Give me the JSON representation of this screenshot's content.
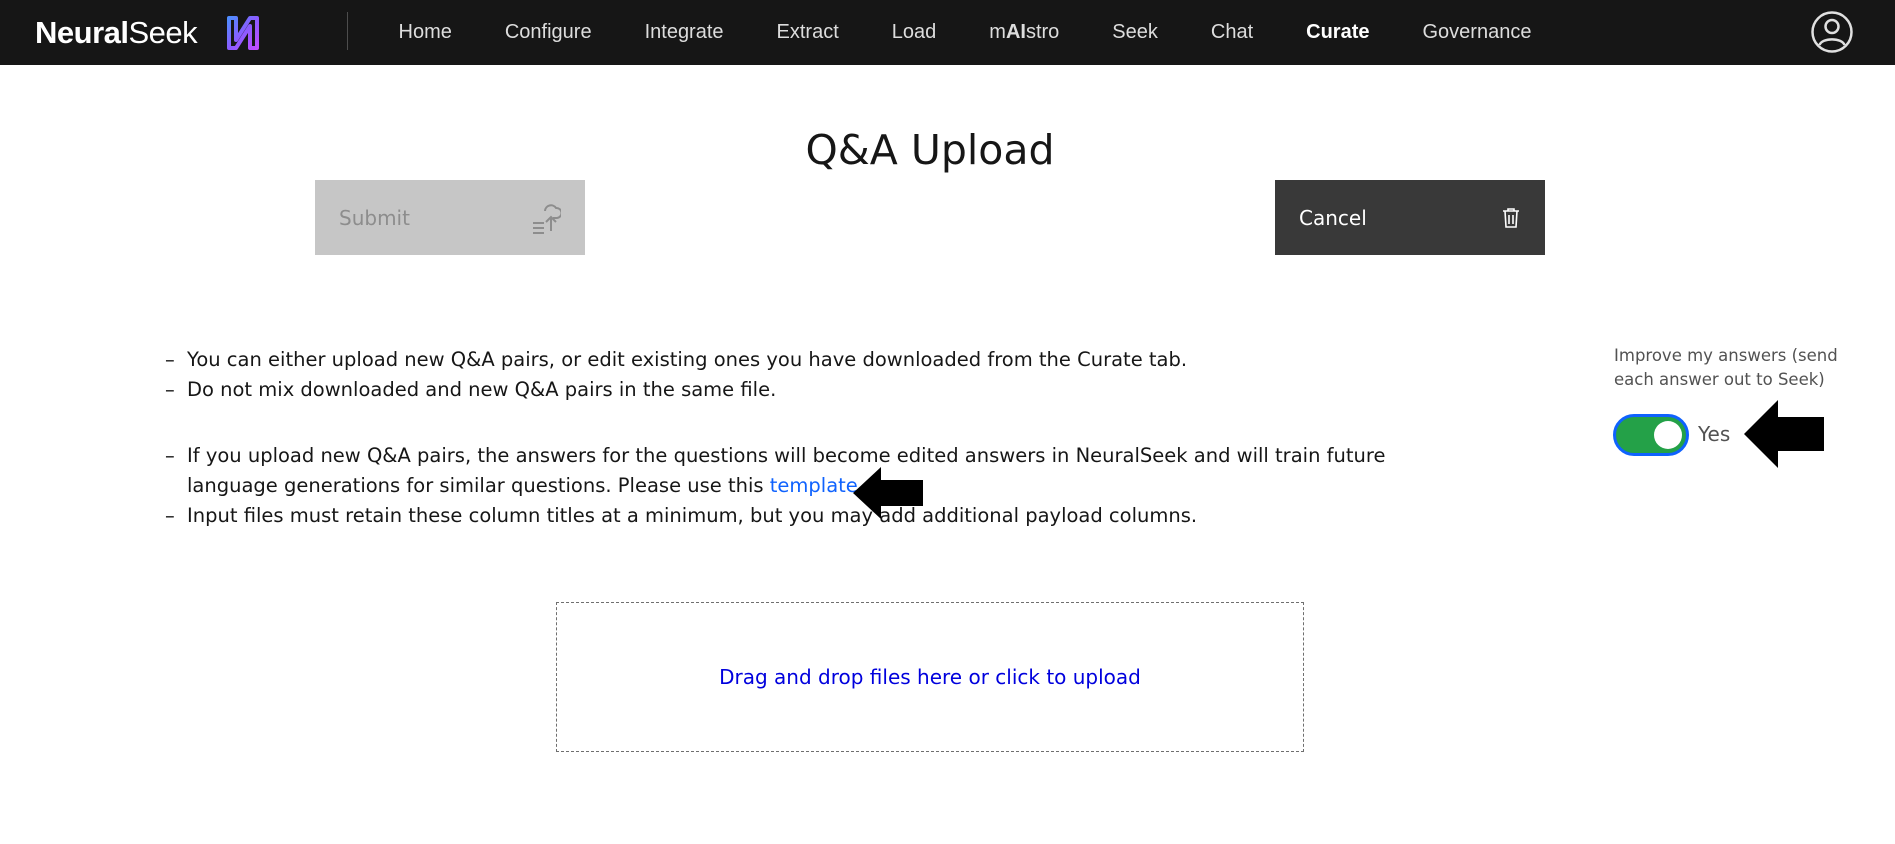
{
  "brand": {
    "name_bold": "Neural",
    "name_regular": "Seek"
  },
  "nav": {
    "items": [
      {
        "label": "Home"
      },
      {
        "label": "Configure"
      },
      {
        "label": "Integrate"
      },
      {
        "label": "Extract"
      },
      {
        "label": "Load"
      },
      {
        "label_prefix": "m",
        "label_ai": "AI",
        "label_suffix": "stro"
      },
      {
        "label": "Seek"
      },
      {
        "label": "Chat"
      },
      {
        "label": "Curate",
        "active": true
      },
      {
        "label": "Governance"
      }
    ]
  },
  "page": {
    "title": "Q&A Upload"
  },
  "actions": {
    "submit_label": "Submit",
    "cancel_label": "Cancel"
  },
  "instructions": {
    "line1": "You can either upload new Q&A pairs, or edit existing ones you have downloaded from the Curate tab.",
    "line2": "Do not mix downloaded and new Q&A pairs in the same file.",
    "line3_text_a": "If you upload new Q&A pairs, the answers for the questions will become edited answers in NeuralSeek and will train future language generations for similar questions. Please use this ",
    "line3_link": "template",
    "line3_text_b": ".",
    "line4": "Input files must retain these column titles at a minimum, but you may add additional payload columns.",
    "dash": "–"
  },
  "dropzone": {
    "label": "Drag and drop files here or click to upload"
  },
  "improve": {
    "label": "Improve my answers (send each answer out to Seek)",
    "state_label": "Yes",
    "enabled": true
  },
  "colors": {
    "topbar": "#161616",
    "toggle_on": "#24a148",
    "focus": "#0f62fe",
    "link": "#0f62fe",
    "dropzone_text": "#0000dd",
    "cancel_bg": "#393939",
    "submit_disabled_bg": "#c6c6c6"
  }
}
